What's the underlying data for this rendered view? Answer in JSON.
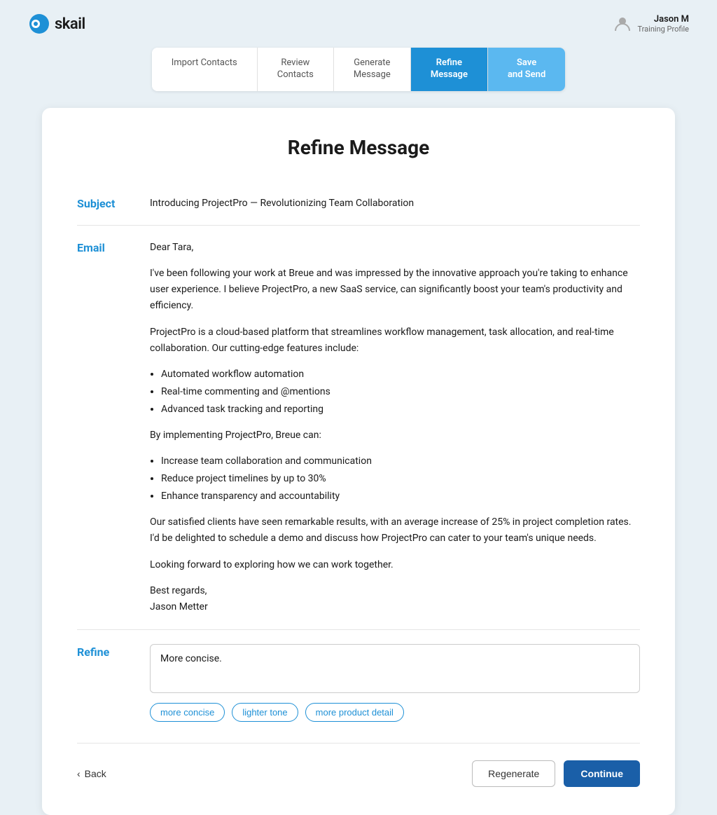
{
  "header": {
    "logo_text": "skail",
    "user_name": "Jason M",
    "user_role": "Training Profile"
  },
  "stepper": {
    "steps": [
      {
        "id": "import-contacts",
        "label": "Import\nContacts",
        "state": "default"
      },
      {
        "id": "review-contacts",
        "label": "Review\nContacts",
        "state": "default"
      },
      {
        "id": "generate-message",
        "label": "Generate\nMessage",
        "state": "default"
      },
      {
        "id": "refine-message",
        "label": "Refine\nMessage",
        "state": "active"
      },
      {
        "id": "save-and-send",
        "label": "Save\nand Send",
        "state": "next"
      }
    ]
  },
  "page": {
    "title": "Refine Message",
    "subject_label": "Subject",
    "subject_value": "Introducing ProjectPro — Revolutionizing Team Collaboration",
    "email_label": "Email",
    "email_content": {
      "greeting": "Dear Tara,",
      "paragraph1": "I've been following your work at Breue and was impressed by the innovative approach you're taking to enhance user experience. I believe ProjectPro, a new SaaS service, can significantly boost your team's productivity and efficiency.",
      "paragraph2": "ProjectPro is a cloud-based platform that streamlines workflow management, task allocation, and real-time collaboration. Our cutting-edge features include:",
      "bullets1": [
        "Automated workflow automation",
        "Real-time commenting and @mentions",
        "Advanced task tracking and reporting"
      ],
      "paragraph3": "By implementing ProjectPro, Breue can:",
      "bullets2": [
        "Increase team collaboration and communication",
        "Reduce project timelines by up to 30%",
        "Enhance transparency and accountability"
      ],
      "paragraph4": "Our satisfied clients have seen remarkable results, with an average increase of 25% in project completion rates. I'd be delighted to schedule a demo and discuss how ProjectPro can cater to your team's unique needs.",
      "paragraph5": "Looking forward to exploring how we can work together.",
      "closing": "Best regards,\nJason Metter"
    },
    "refine_label": "Refine",
    "refine_placeholder": "More concise.",
    "chips": [
      "more concise",
      "lighter tone",
      "more product detail"
    ],
    "back_label": "Back",
    "regenerate_label": "Regenerate",
    "continue_label": "Continue"
  }
}
